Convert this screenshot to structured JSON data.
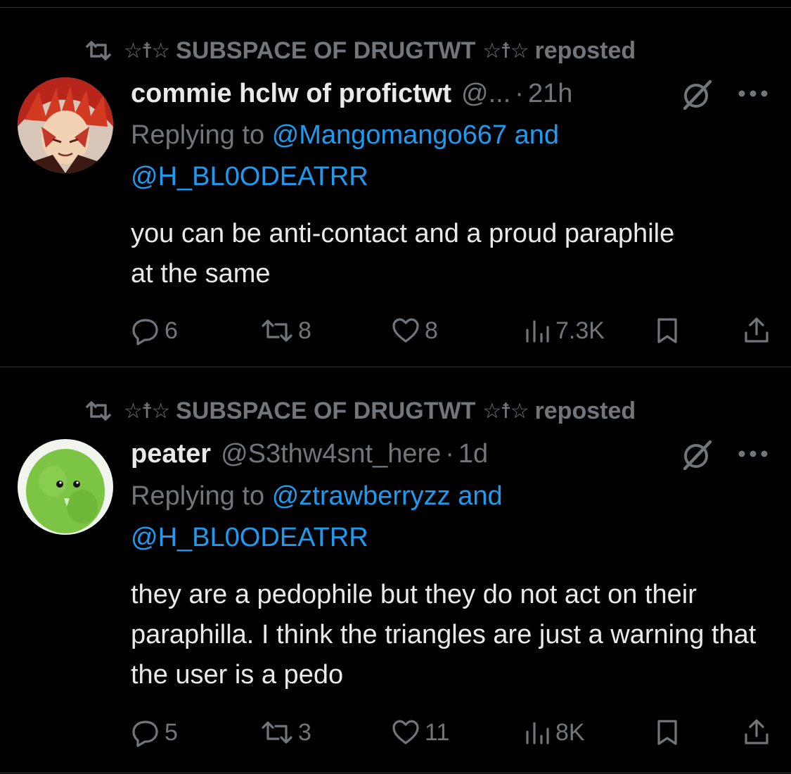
{
  "posts": [
    {
      "reposted_by": "SUBSPACE OF DRUGTWT",
      "deco_left": "☆☨☆",
      "deco_right": "☆☨☆",
      "reposted_suffix": "reposted",
      "display_name": "commie hclw of profictwt",
      "handle": "@...",
      "time": "21h",
      "replying_prefix": "Replying to",
      "mentions": [
        "@Mangomango667",
        "@H_BL0ODEATRR"
      ],
      "mention_joiner": "and",
      "body": "you can be anti-contact and a proud paraphile at the same",
      "replies": "6",
      "reposts": "8",
      "likes": "8",
      "views": "7.3K",
      "avatar_colors": [
        "#c0392b",
        "#f4d8b8"
      ]
    },
    {
      "reposted_by": "SUBSPACE OF DRUGTWT",
      "deco_left": "☆☨☆",
      "deco_right": "☆☨☆",
      "reposted_suffix": "reposted",
      "display_name": "peater",
      "handle": "@S3thw4snt_here",
      "time": "1d",
      "replying_prefix": "Replying to",
      "mentions": [
        "@ztrawberryzz",
        "@H_BL0ODEATRR"
      ],
      "mention_joiner": "and",
      "body": "they are a pedophile but they do not act on their paraphilla. I think the triangles are just a warning that the user is a pedo",
      "replies": "5",
      "reposts": "3",
      "likes": "11",
      "views": "8K",
      "avatar_colors": [
        "#7cc444",
        "#f2f5ee"
      ]
    }
  ],
  "theme": {
    "background": "#000000",
    "text": "#e7e9ea",
    "muted": "#71767b",
    "link": "#1d9bf0",
    "divider": "#2f3336"
  },
  "icons": [
    "repost-icon",
    "grok-icon",
    "more-icon",
    "reply-icon",
    "retweet-icon",
    "like-icon",
    "views-icon",
    "bookmark-icon",
    "share-icon"
  ]
}
